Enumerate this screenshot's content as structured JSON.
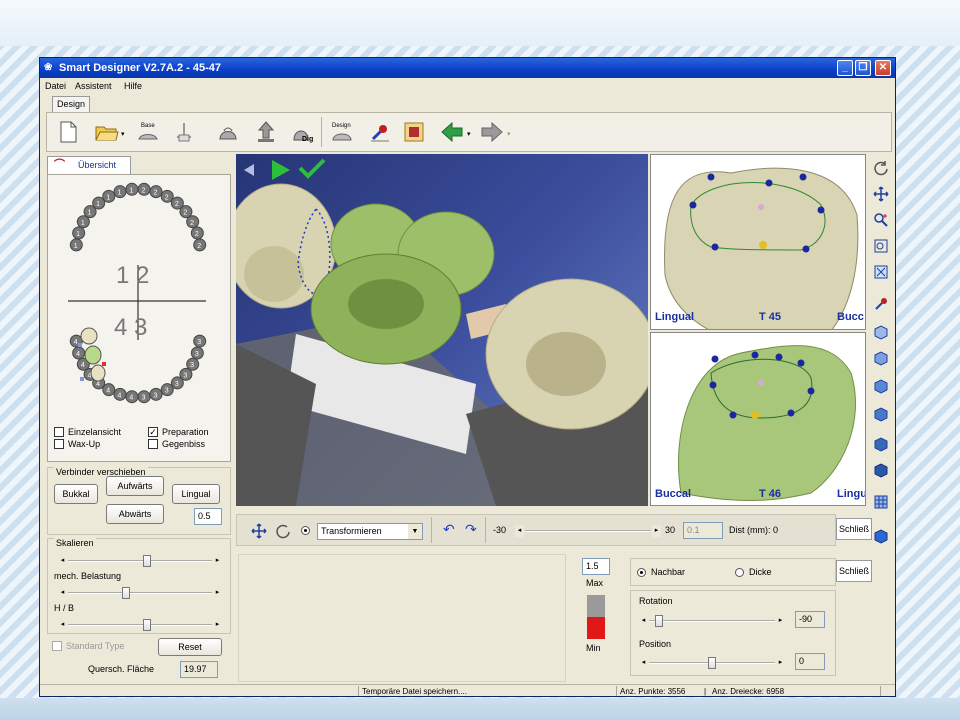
{
  "window": {
    "title": "Smart Designer V2.7A.2 - 45-47"
  },
  "menu": [
    "Datei",
    "Assistent",
    "Hilfe"
  ],
  "ribbon_tab": "Design",
  "toolbar": {
    "base_label": "Base",
    "dig_label": "Dig",
    "design_label": "Design"
  },
  "overview": {
    "tab_label": "Übersicht",
    "quadrant_12": "1 2",
    "quadrant_43": "4 3",
    "upper_teeth": [
      "1",
      "1",
      "1",
      "1",
      "1",
      "1",
      "1",
      "1",
      "2",
      "2",
      "2",
      "2",
      "2",
      "2",
      "2",
      "2"
    ],
    "lower_teeth": [
      "4",
      "4",
      "4",
      "4",
      "4",
      "4",
      "4",
      "4",
      "3",
      "3",
      "3",
      "3",
      "3",
      "3",
      "3",
      "3"
    ],
    "checkboxes": [
      {
        "label": "Einzelansicht",
        "checked": false
      },
      {
        "label": "Preparation",
        "checked": true
      },
      {
        "label": "Wax-Up",
        "checked": false
      },
      {
        "label": "Gegenbiss",
        "checked": false
      }
    ]
  },
  "connector": {
    "title": "Verbinder verschieben",
    "bukkal": "Bukkal",
    "aufwaerts": "Aufwärts",
    "lingual": "Lingual",
    "abwaerts": "Abwärts",
    "step_value": "0.5"
  },
  "scale": {
    "title": "Skalieren",
    "mech_label": "mech. Belastung",
    "hb_label": "H / B",
    "slider_positions": [
      0.55,
      0.4,
      0.55
    ]
  },
  "standard_type": {
    "label": "Standard Type",
    "checked": false
  },
  "reset_label": "Reset",
  "cross_section": {
    "label": "Quersch. Fläche",
    "value": "19.97"
  },
  "views": {
    "top_left": "Lingual",
    "top_center": "T 45",
    "top_right": "Bucc",
    "bottom_left": "Buccal",
    "bottom_center": "T 46",
    "bottom_right": "Lingu"
  },
  "controls": {
    "mode_select": "Transformieren",
    "range_min": "-30",
    "range_max": "30",
    "range_value": "0.1",
    "dist_label": "Dist (mm): 0"
  },
  "side_tabs": [
    "Schließ",
    "Schließ"
  ],
  "scale_bar": {
    "max_value": "1.5",
    "max_label": "Max",
    "min_label": "Min"
  },
  "transform_panel": {
    "radio_nachbar": "Nachbar",
    "radio_dicke": "Dicke",
    "selected": "Nachbar",
    "rotation_label": "Rotation",
    "rotation_value": "-90",
    "rotation_fraction": 0.05,
    "position_label": "Position",
    "position_value": "0",
    "position_fraction": 0.5
  },
  "status": {
    "message": "Temporäre Datei speichern....",
    "points": "Anz. Punkte: 3556",
    "triangles": "Anz. Dreiecke: 6958"
  },
  "colors": {
    "title_bar": "#0a3fc8",
    "crown_green": "#9dbf6a",
    "tooth_beige": "#d8d3b0",
    "scale_red": "#e01818",
    "scale_gray": "#9a9a9a",
    "view_label_blue": "#1a2fa0"
  }
}
